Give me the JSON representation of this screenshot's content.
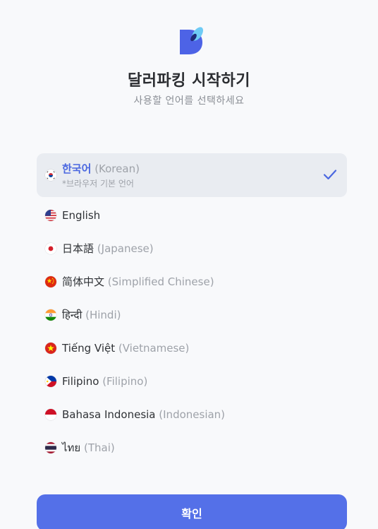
{
  "header": {
    "logo_icon": "app-logo-icon",
    "title": "달러파킹 시작하기",
    "subtitle": "사용할 언어를 선택하세요"
  },
  "languages": [
    {
      "flag": "kr-flag-icon",
      "native": "한국어",
      "english": "(Korean)",
      "note": "*브라우저 기본 언어",
      "selected": true
    },
    {
      "flag": "us-flag-icon",
      "native": "English",
      "english": "",
      "selected": false
    },
    {
      "flag": "jp-flag-icon",
      "native": "日本語",
      "english": "(Japanese)",
      "selected": false
    },
    {
      "flag": "cn-flag-icon",
      "native": "简体中文",
      "english": "(Simplified Chinese)",
      "selected": false
    },
    {
      "flag": "in-flag-icon",
      "native": "हिन्दी",
      "english": "(Hindi)",
      "selected": false
    },
    {
      "flag": "vn-flag-icon",
      "native": "Tiếng Việt",
      "english": "(Vietnamese)",
      "selected": false
    },
    {
      "flag": "ph-flag-icon",
      "native": "Filipino",
      "english": "(Filipino)",
      "selected": false
    },
    {
      "flag": "id-flag-icon",
      "native": "Bahasa Indonesia",
      "english": "(Indonesian)",
      "selected": false
    },
    {
      "flag": "th-flag-icon",
      "native": "ไทย",
      "english": "(Thai)",
      "selected": false
    }
  ],
  "confirm_button": {
    "label": "확인"
  },
  "colors": {
    "accent": "#5470e8",
    "selected_bg": "#e9ecf1",
    "selected_text": "#4a67e0",
    "background": "#f8f9fb"
  }
}
